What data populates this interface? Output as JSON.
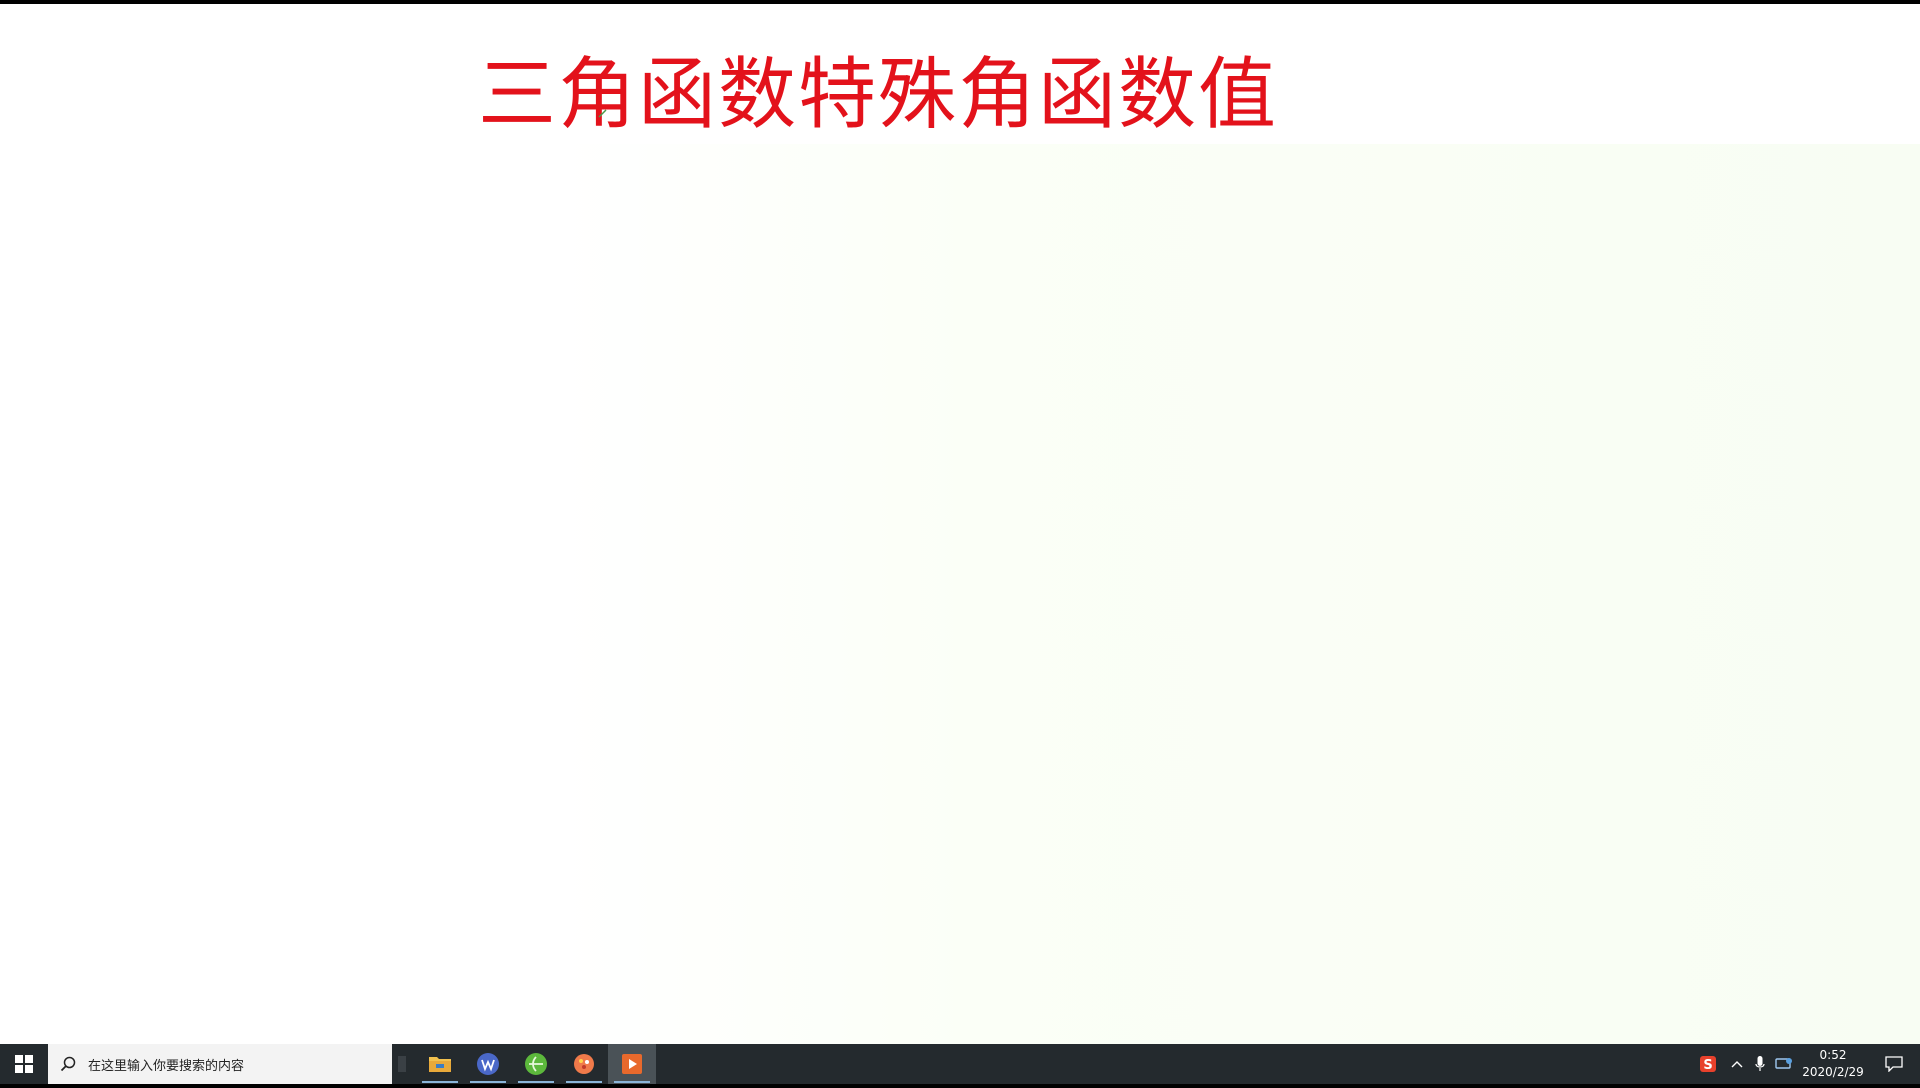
{
  "slide": {
    "title": "三角函数特殊角函数值",
    "title_color": "#e3121b"
  },
  "taskbar": {
    "search_placeholder": "在这里输入你要搜索的内容",
    "apps": [
      {
        "name": "file-explorer",
        "icon": "folder-icon"
      },
      {
        "name": "wps-writer",
        "icon": "wps-icon"
      },
      {
        "name": "browser",
        "icon": "browser-icon"
      },
      {
        "name": "paint-app",
        "icon": "paint-icon"
      },
      {
        "name": "presentation",
        "icon": "slideshow-icon",
        "active": true
      }
    ],
    "tray": {
      "ime_label": "S",
      "time": "0:52",
      "date": "2020/2/29"
    }
  }
}
